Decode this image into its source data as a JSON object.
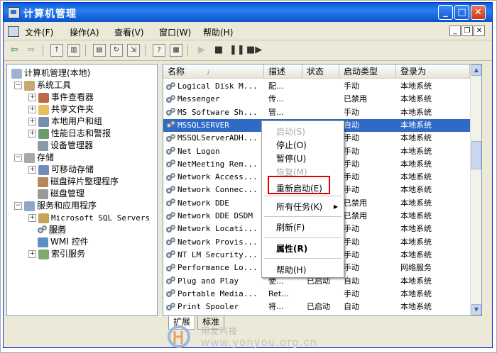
{
  "window": {
    "title": "计算机管理"
  },
  "menubar": {
    "items": [
      "文件(F)",
      "操作(A)",
      "查看(V)",
      "窗口(W)",
      "帮助(H)"
    ]
  },
  "tree": [
    {
      "label": "计算机管理(本地)"
    },
    {
      "label": "系统工具"
    },
    {
      "label": "事件查看器"
    },
    {
      "label": "共享文件夹"
    },
    {
      "label": "本地用户和组"
    },
    {
      "label": "性能日志和警报"
    },
    {
      "label": "设备管理器"
    },
    {
      "label": "存储"
    },
    {
      "label": "可移动存储"
    },
    {
      "label": "磁盘碎片整理程序"
    },
    {
      "label": "磁盘管理"
    },
    {
      "label": "服务和应用程序"
    },
    {
      "label": "Microsoft SQL Servers"
    },
    {
      "label": "服务"
    },
    {
      "label": "WMI 控件"
    },
    {
      "label": "索引服务"
    }
  ],
  "list": {
    "columns": [
      "名称",
      "描述",
      "状态",
      "启动类型",
      "登录为"
    ],
    "rows": [
      {
        "name": "Logical Disk M...",
        "desc": "配...",
        "status": "",
        "startup": "手动",
        "logon": "本地系统"
      },
      {
        "name": "Messenger",
        "desc": "传...",
        "status": "",
        "startup": "已禁用",
        "logon": "本地系统"
      },
      {
        "name": "MS Software Sh...",
        "desc": "管...",
        "status": "",
        "startup": "手动",
        "logon": "本地系统"
      },
      {
        "name": "MSSQLSERVER",
        "desc": "",
        "status": "",
        "startup": "自动",
        "logon": "本地系统"
      },
      {
        "name": "MSSQLServerADH...",
        "desc": "",
        "status": "",
        "startup": "手动",
        "logon": "本地系统"
      },
      {
        "name": "Net Logon",
        "desc": "",
        "status": "",
        "startup": "手动",
        "logon": "本地系统"
      },
      {
        "name": "NetMeeting Rem...",
        "desc": "",
        "status": "",
        "startup": "手动",
        "logon": "本地系统"
      },
      {
        "name": "Network Access...",
        "desc": "",
        "status": "",
        "startup": "手动",
        "logon": "本地系统"
      },
      {
        "name": "Network Connec...",
        "desc": "",
        "status": "",
        "startup": "手动",
        "logon": "本地系统"
      },
      {
        "name": "Network DDE",
        "desc": "",
        "status": "",
        "startup": "已禁用",
        "logon": "本地系统"
      },
      {
        "name": "Network DDE DSDM",
        "desc": "",
        "status": "",
        "startup": "已禁用",
        "logon": "本地系统"
      },
      {
        "name": "Network Locati...",
        "desc": "",
        "status": "",
        "startup": "手动",
        "logon": "本地系统"
      },
      {
        "name": "Network Provis...",
        "desc": "",
        "status": "",
        "startup": "手动",
        "logon": "本地系统"
      },
      {
        "name": "NT LM Security...",
        "desc": "",
        "status": "",
        "startup": "手动",
        "logon": "本地系统"
      },
      {
        "name": "Performance Lo...",
        "desc": "",
        "status": "",
        "startup": "手动",
        "logon": "网络服务"
      },
      {
        "name": "Plug and Play",
        "desc": "使...",
        "status": "已启动",
        "startup": "自动",
        "logon": "本地系统"
      },
      {
        "name": "Portable Media...",
        "desc": "Ret...",
        "status": "",
        "startup": "手动",
        "logon": "本地系统"
      },
      {
        "name": "Print Spooler",
        "desc": "将...",
        "status": "已启动",
        "startup": "自动",
        "logon": "本地系统"
      }
    ]
  },
  "tabs": [
    "扩展",
    "标准"
  ],
  "context_menu": {
    "items": [
      {
        "label": "启动(S)",
        "disabled": true
      },
      {
        "label": "停止(O)"
      },
      {
        "label": "暂停(U)"
      },
      {
        "label": "恢复(M)",
        "disabled": true
      },
      {
        "label": "重新启动(E)"
      },
      {
        "label": "所有任务(K)",
        "submenu": true
      },
      {
        "label": "刷新(F)"
      },
      {
        "label": "属性(R)",
        "bold": true
      },
      {
        "label": "帮助(H)"
      }
    ]
  },
  "watermark": {
    "cn": "用友科技",
    "url": "www.yonyou.org.cn"
  },
  "colors": {
    "titlebar": "#0a5fd8",
    "selection": "#316ac5",
    "highlight_box": "#e00000"
  }
}
